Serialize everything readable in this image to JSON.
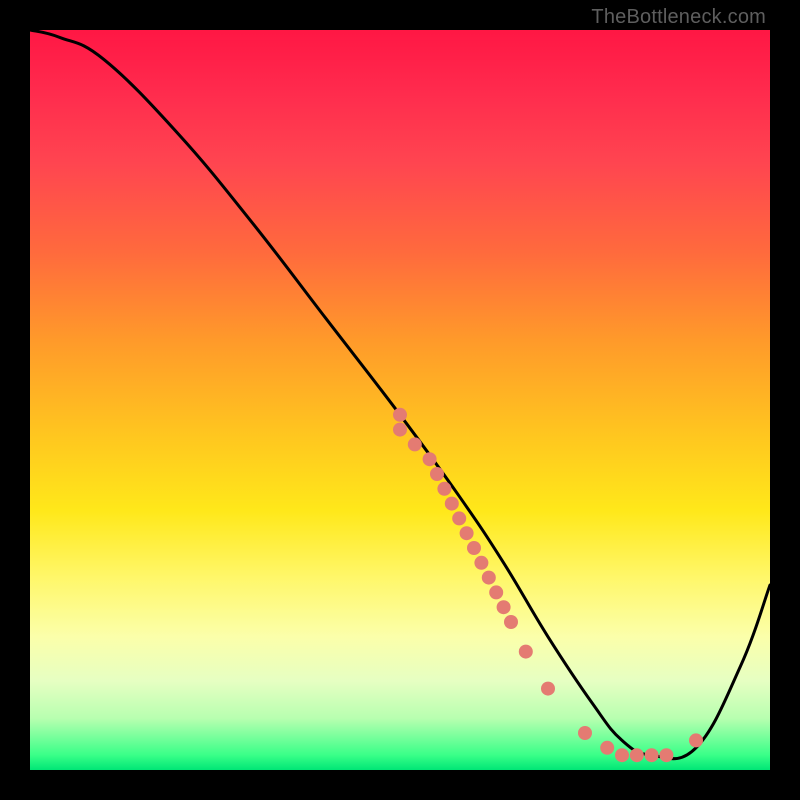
{
  "attribution": "TheBottleneck.com",
  "chart_data": {
    "type": "line",
    "title": "",
    "xlabel": "",
    "ylabel": "",
    "xlim": [
      0,
      100
    ],
    "ylim": [
      0,
      100
    ],
    "series": [
      {
        "name": "bottleneck-curve",
        "x": [
          0,
          4,
          10,
          20,
          30,
          40,
          50,
          58,
          64,
          70,
          76,
          80,
          84,
          90,
          96,
          100
        ],
        "values": [
          100,
          99,
          96,
          86,
          74,
          61,
          48,
          37,
          28,
          18,
          9,
          4,
          2,
          3,
          14,
          25
        ]
      }
    ],
    "markers": {
      "name": "observed-points",
      "color": "#e47b72",
      "x": [
        50,
        50,
        52,
        54,
        55,
        56,
        57,
        58,
        59,
        60,
        61,
        62,
        63,
        64,
        65,
        67,
        70,
        75,
        78,
        80,
        82,
        84,
        86,
        90
      ],
      "values": [
        48,
        46,
        44,
        42,
        40,
        38,
        36,
        34,
        32,
        30,
        28,
        26,
        24,
        22,
        20,
        16,
        11,
        5,
        3,
        2,
        2,
        2,
        2,
        4
      ]
    }
  }
}
